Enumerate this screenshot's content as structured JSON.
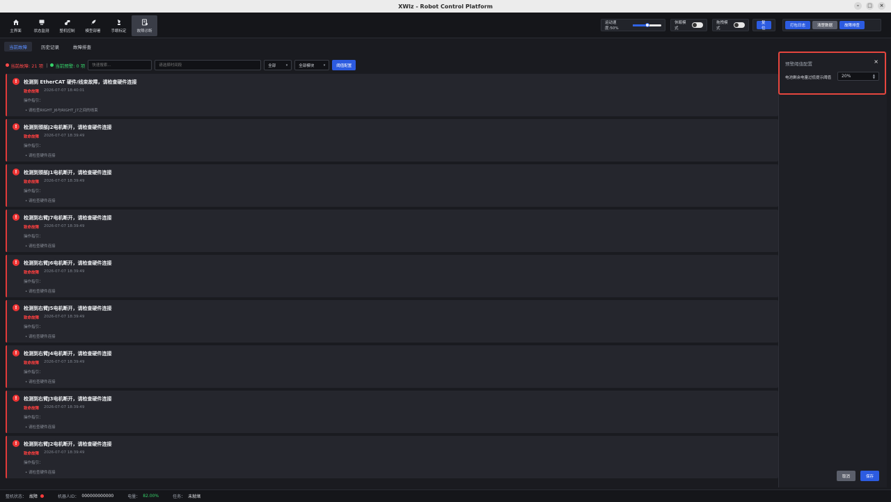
{
  "window": {
    "title": "XWlz - Robot Control Platform"
  },
  "nav": [
    {
      "label": "主界面",
      "icon": "home-icon"
    },
    {
      "label": "状态监测",
      "icon": "monitor-icon"
    },
    {
      "label": "整机控制",
      "icon": "robot-control-icon"
    },
    {
      "label": "模型部署",
      "icon": "rocket-icon"
    },
    {
      "label": "手眼标定",
      "icon": "calibrate-icon"
    },
    {
      "label": "故障诊断",
      "icon": "diagnosis-icon",
      "active": true
    }
  ],
  "controls": {
    "speed_label": "运动速度:50%",
    "speed_level": 0.5,
    "sleep_label": "休眠模式",
    "drag_label": "拖拽模式",
    "reset_label": "复位",
    "pack_log_label": "打包日志",
    "clear_data_label": "清楚数据",
    "troubleshoot_label": "故障排查"
  },
  "subtabs": [
    "当前故障",
    "历史记录",
    "故障排查"
  ],
  "filters": {
    "fault_count": "当前故障: 21 项",
    "warning_count": "当前预警: 0 项",
    "search_placeholder": "快速搜索...",
    "time_placeholder": "请选择时间段",
    "level_value": "全部",
    "module_value": "全部模块",
    "threshold_button": "阈值配置"
  },
  "faults": [
    {
      "title": "检测到 EtherCAT 硬件/线束故障，请检查硬件连接",
      "level": "致命故障",
      "time": "2026-07-07 18:40:01",
      "guide": "操作指引：",
      "step": "请检查RIGHT_J6与RIGHT_J7之间的线束"
    },
    {
      "title": "检测到颈部J2电机断开，请检查硬件连接",
      "level": "致命故障",
      "time": "2026-07-07 18:39:49",
      "guide": "操作指引：",
      "step": "请检查硬件连接"
    },
    {
      "title": "检测到颈部J1电机断开，请检查硬件连接",
      "level": "致命故障",
      "time": "2026-07-07 18:39:49",
      "guide": "操作指引：",
      "step": "请检查硬件连接"
    },
    {
      "title": "检测到右臂J7电机断开，请检查硬件连接",
      "level": "致命故障",
      "time": "2026-07-07 18:39:49",
      "guide": "操作指引：",
      "step": "请检查硬件连接"
    },
    {
      "title": "检测到右臂J6电机断开，请检查硬件连接",
      "level": "致命故障",
      "time": "2026-07-07 18:39:49",
      "guide": "操作指引：",
      "step": "请检查硬件连接"
    },
    {
      "title": "检测到右臂J5电机断开，请检查硬件连接",
      "level": "致命故障",
      "time": "2026-07-07 18:39:49",
      "guide": "操作指引：",
      "step": "请检查硬件连接"
    },
    {
      "title": "检测到右臂J4电机断开，请检查硬件连接",
      "level": "致命故障",
      "time": "2026-07-07 18:39:49",
      "guide": "操作指引：",
      "step": "请检查硬件连接"
    },
    {
      "title": "检测到右臂J3电机断开，请检查硬件连接",
      "level": "致命故障",
      "time": "2026-07-07 18:39:49",
      "guide": "操作指引：",
      "step": "请检查硬件连接"
    },
    {
      "title": "检测到右臂J2电机断开，请检查硬件连接",
      "level": "致命故障",
      "time": "2026-07-07 18:39:49",
      "guide": "操作指引：",
      "step": "请检查硬件连接"
    }
  ],
  "panel": {
    "title": "预警阈值配置",
    "battery_label": "电池剩余电量过低提示阈值",
    "battery_value": "20%",
    "cancel_label": "取消",
    "save_label": "保存"
  },
  "status": {
    "machine_label": "整机状态：",
    "machine_value": "故障",
    "robot_id_label": "机器人ID：",
    "robot_id_value": "000000000000",
    "battery_label": "电量：",
    "battery_value": "82.00%",
    "task_label": "任务：",
    "task_value": "未就绪"
  },
  "colors": {
    "accent": "#2c5be0",
    "fault": "#e03a3a",
    "ok": "#36d36a"
  }
}
